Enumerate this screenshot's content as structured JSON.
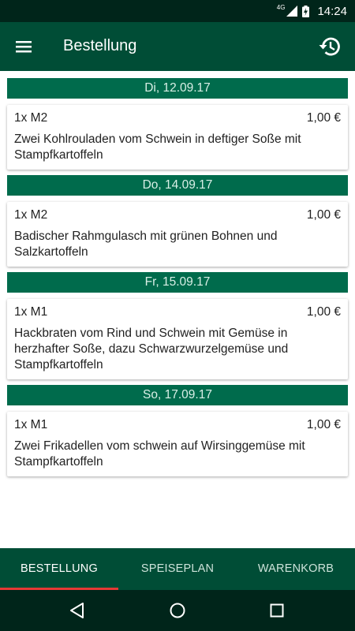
{
  "status_bar": {
    "network": "4G",
    "time": "14:24"
  },
  "app_bar": {
    "title": "Bestellung"
  },
  "orders": [
    {
      "date": "Di, 12.09.17",
      "quantity_item": "1x M2",
      "price": "1,00 €",
      "description": "Zwei Kohlrouladen vom Schwein in deftiger Soße mit Stampfkartoffeln"
    },
    {
      "date": "Do, 14.09.17",
      "quantity_item": "1x M2",
      "price": "1,00 €",
      "description": "Badischer Rahmgulasch mit grünen Bohnen und Salzkartoffeln"
    },
    {
      "date": "Fr, 15.09.17",
      "quantity_item": "1x M1",
      "price": "1,00 €",
      "description": "Hackbraten vom Rind und Schwein mit Gemüse in herzhafter Soße, dazu Schwarzwurzelgemüse und Stampfkartoffeln"
    },
    {
      "date": "So, 17.09.17",
      "quantity_item": "1x M1",
      "price": "1,00 €",
      "description": "Zwei Frikadellen vom schwein auf Wirsinggemüse mit Stampfkartoffeln"
    }
  ],
  "tabs": [
    {
      "label": "BESTELLUNG",
      "active": true
    },
    {
      "label": "SPEISEPLAN",
      "active": false
    },
    {
      "label": "WARENKORB",
      "active": false
    }
  ],
  "icons": {
    "menu": "hamburger-menu-icon",
    "history": "history-icon",
    "back": "back-triangle-icon",
    "home": "home-circle-icon",
    "recents": "recents-square-icon"
  },
  "colors": {
    "status_bar": "#00251a",
    "primary": "#004d36",
    "date_header": "#006b4c",
    "tab_indicator": "#e53935"
  }
}
